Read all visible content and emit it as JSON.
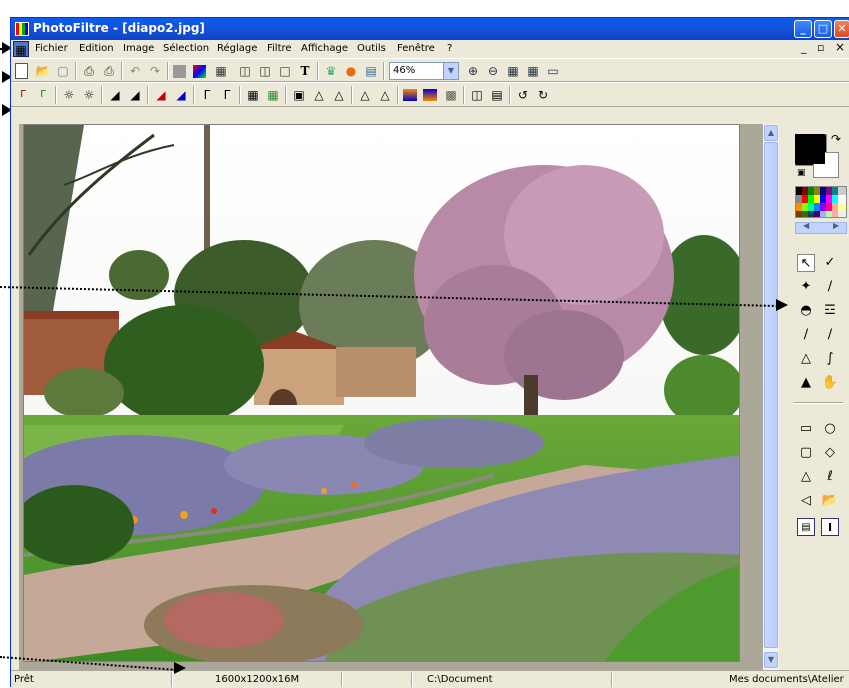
{
  "window": {
    "title": "PhotoFiltre - [diapo2.jpg]",
    "minimize_glyph": "_",
    "maximize_glyph": "□",
    "close_glyph": "✕",
    "mdi_min_glyph": "_",
    "mdi_restore_glyph": "▫",
    "mdi_close_glyph": "×"
  },
  "menubar": {
    "items": [
      "Fichier",
      "Edition",
      "Image",
      "Sélection",
      "Réglage",
      "Filtre",
      "Affichage",
      "Outils",
      "Fenêtre",
      "?"
    ]
  },
  "toolbar": {
    "zoom_value": "46%"
  },
  "statusbar": {
    "state": "Prêt",
    "dimensions": "1600x1200x16M",
    "path": "C:\\Document",
    "folder": "Mes documents\\Atelier"
  },
  "colors": {
    "titlebar": "#0a5ef0",
    "window_bg": "#ece9d8",
    "close_button": "#e0502a"
  }
}
